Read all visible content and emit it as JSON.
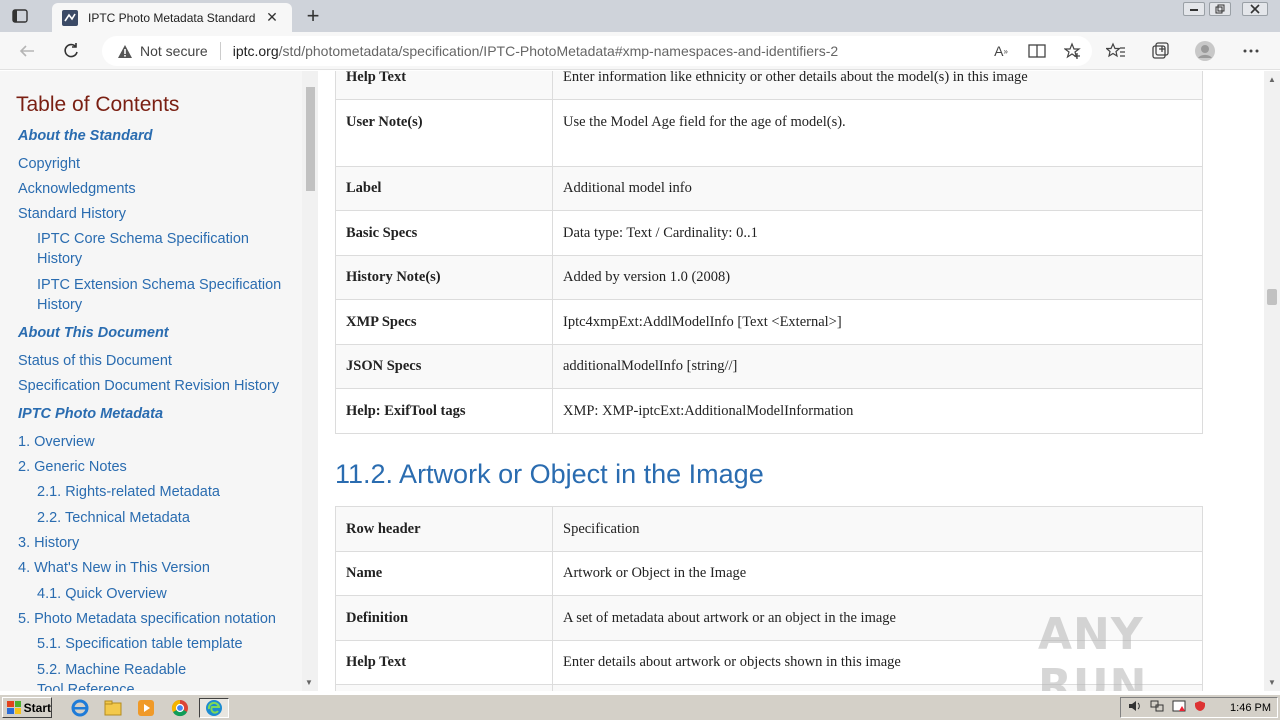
{
  "browser": {
    "tab_title": "IPTC Photo Metadata Standard",
    "tab_close": "✕",
    "new_tab": "+",
    "security_label": "Not secure",
    "url_host": "iptc.org",
    "url_path": "/std/photometadata/specification/IPTC-PhotoMetadata#xmp-namespaces-and-identifiers-2"
  },
  "toc": {
    "title": "Table of Contents",
    "items": [
      {
        "label": "About the Standard",
        "kind": "section"
      },
      {
        "label": "Copyright",
        "kind": "item"
      },
      {
        "label": "Acknowledgments",
        "kind": "item"
      },
      {
        "label": "Standard History",
        "kind": "item"
      },
      {
        "label": "IPTC Core Schema Specification",
        "kind": "sub"
      },
      {
        "label": "History",
        "kind": "sub"
      },
      {
        "label": "IPTC Extension Schema Specification",
        "kind": "sub"
      },
      {
        "label": "History",
        "kind": "sub"
      },
      {
        "label": "About This Document",
        "kind": "section"
      },
      {
        "label": "Status of this Document",
        "kind": "item"
      },
      {
        "label": "Specification Document Revision History",
        "kind": "item"
      },
      {
        "label": "IPTC Photo Metadata",
        "kind": "section"
      },
      {
        "label": "1. Overview",
        "kind": "item"
      },
      {
        "label": "2. Generic Notes",
        "kind": "item"
      },
      {
        "label": "2.1. Rights-related Metadata",
        "kind": "sub"
      },
      {
        "label": "2.2. Technical Metadata",
        "kind": "sub"
      },
      {
        "label": "3. History",
        "kind": "item"
      },
      {
        "label": "4. What's New in This Version",
        "kind": "item"
      },
      {
        "label": "4.1. Quick Overview",
        "kind": "sub"
      },
      {
        "label": "5. Photo Metadata specification notation",
        "kind": "item"
      },
      {
        "label": "5.1. Specification table template",
        "kind": "sub"
      },
      {
        "label": "5.2. Machine Readable",
        "kind": "sub"
      },
      {
        "label": "Tool Reference",
        "kind": "sub"
      }
    ]
  },
  "table1": [
    {
      "k": "Help Text",
      "v": "Enter information like ethnicity or other details about the model(s) in this image"
    },
    {
      "k": "User Note(s)",
      "v": "Use the Model Age field for the age of model(s)."
    },
    {
      "k": "Label",
      "v": "Additional model info"
    },
    {
      "k": "Basic Specs",
      "v": "Data type: Text / Cardinality: 0..1"
    },
    {
      "k": "History Note(s)",
      "v": "Added by version 1.0 (2008)"
    },
    {
      "k": "XMP Specs",
      "v": "Iptc4xmpExt:AddlModelInfo [Text <External>]"
    },
    {
      "k": "JSON Specs",
      "v": "additionalModelInfo [string//]"
    },
    {
      "k": "Help: ExifTool tags",
      "v": "XMP: XMP-iptcExt:AdditionalModelInformation"
    }
  ],
  "section_heading": "11.2. Artwork or Object in the Image",
  "table2": [
    {
      "k": "Row header",
      "v": "Specification"
    },
    {
      "k": "Name",
      "v": "Artwork or Object in the Image"
    },
    {
      "k": "Definition",
      "v": "A set of metadata about artwork or an object in the image"
    },
    {
      "k": "Help Text",
      "v": "Enter details about artwork or objects shown in this image"
    },
    {
      "k": "",
      "v": ""
    }
  ],
  "watermark": "ANY RUN",
  "taskbar": {
    "start_label": "Start",
    "clock": "1:46 PM"
  }
}
